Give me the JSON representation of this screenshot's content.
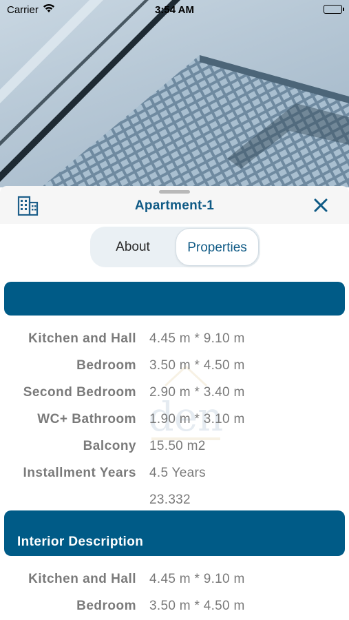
{
  "status_bar": {
    "carrier": "Carrier",
    "time": "3:54 AM"
  },
  "sheet": {
    "title": "Apartment-1"
  },
  "tabs": [
    {
      "label": "About",
      "selected": false
    },
    {
      "label": "Properties",
      "selected": true
    }
  ],
  "properties_section": {
    "title": "",
    "rows": [
      {
        "label": "Kitchen and Hall",
        "value": "4.45 m * 9.10 m"
      },
      {
        "label": "Bedroom",
        "value": "3.50 m * 4.50 m"
      },
      {
        "label": "Second Bedroom",
        "value": "2.90 m * 3.40 m"
      },
      {
        "label": "WC+ Bathroom",
        "value": "1.90 m * 3.10 m"
      },
      {
        "label": "Balcony",
        "value": "15.50 m2"
      },
      {
        "label": "Installment Years",
        "value": "4.5 Years"
      },
      {
        "label": "",
        "value": "23.332"
      }
    ]
  },
  "interior_section": {
    "title": "Interior Description",
    "rows": [
      {
        "label": "Kitchen and Hall",
        "value": "4.45 m * 9.10 m"
      },
      {
        "label": "Bedroom",
        "value": "3.50 m * 4.50 m"
      }
    ]
  },
  "colors": {
    "accent": "#005b87",
    "title": "#0f5a85",
    "text": "#7a7a7a",
    "header_bg": "#f6f6f6"
  }
}
